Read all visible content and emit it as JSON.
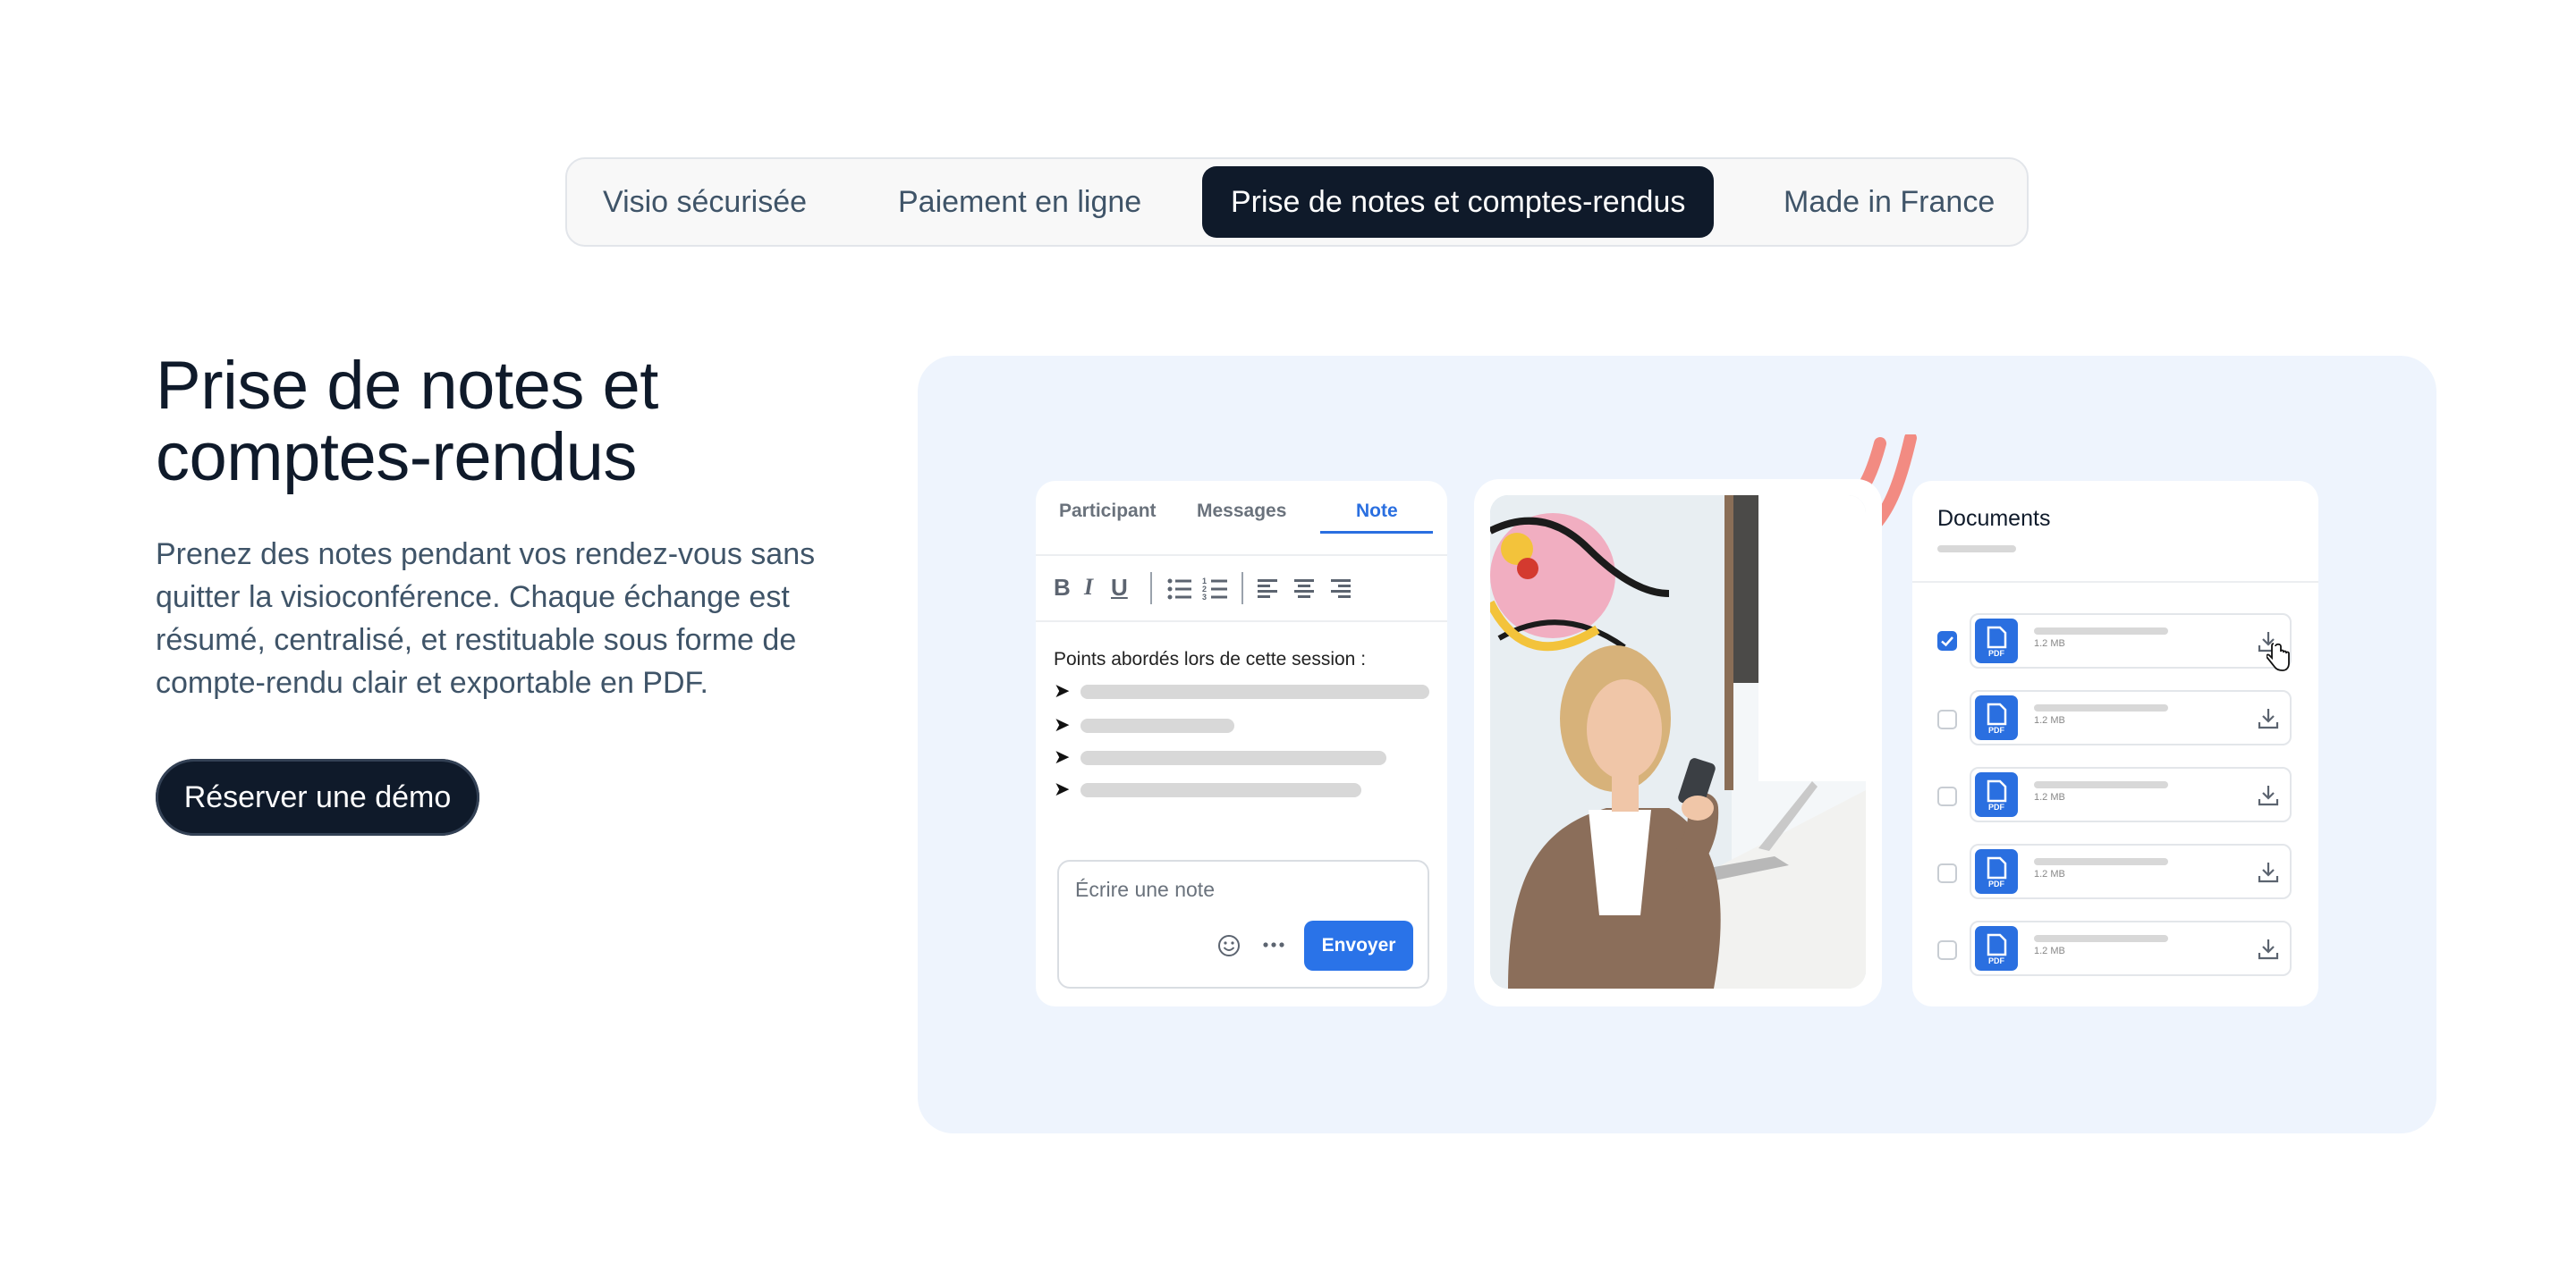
{
  "tabs": [
    {
      "label": "Visio sécurisée",
      "active": false
    },
    {
      "label": "Paiement en ligne",
      "active": false
    },
    {
      "label": "Prise de notes et comptes-rendus",
      "active": true
    },
    {
      "label": "Made in France",
      "active": false
    }
  ],
  "hero": {
    "title": "Prise de notes et comptes-rendus",
    "description": "Prenez des notes pendant vos rendez-vous sans quitter la visioconférence. Chaque échange est résumé, centralisé, et restituable sous forme de compte-rendu clair et exportable en PDF.",
    "cta_label": "Réserver une démo"
  },
  "notes_card": {
    "tabs": [
      "Participant",
      "Messages",
      "Note"
    ],
    "active_tab": "Note",
    "toolbar_icons": [
      "bold-icon",
      "italic-icon",
      "underline-icon",
      "bullet-list-icon",
      "numbered-list-icon",
      "align-left-icon",
      "align-center-icon",
      "align-right-icon"
    ],
    "toolbar": {
      "bold": "B",
      "italic": "I",
      "underline": "U"
    },
    "points_heading": "Points abordés lors de cette session :",
    "bullet_glyph": "➤",
    "composer_placeholder": "Écrire une note",
    "send_label": "Envoyer"
  },
  "documents_card": {
    "title": "Documents",
    "pdf_badge": "PDF",
    "files": [
      {
        "size": "1.2 MB",
        "checked": true
      },
      {
        "size": "1.2 MB",
        "checked": false
      },
      {
        "size": "1.2 MB",
        "checked": false
      },
      {
        "size": "1.2 MB",
        "checked": false
      },
      {
        "size": "1.2 MB",
        "checked": false
      }
    ]
  },
  "colors": {
    "dark_navy": "#0f1a2a",
    "accent_blue": "#2a6fe0",
    "panel_bg": "#eef4fd",
    "muted_text": "#3f5468",
    "decor_coral": "#f28b82"
  }
}
